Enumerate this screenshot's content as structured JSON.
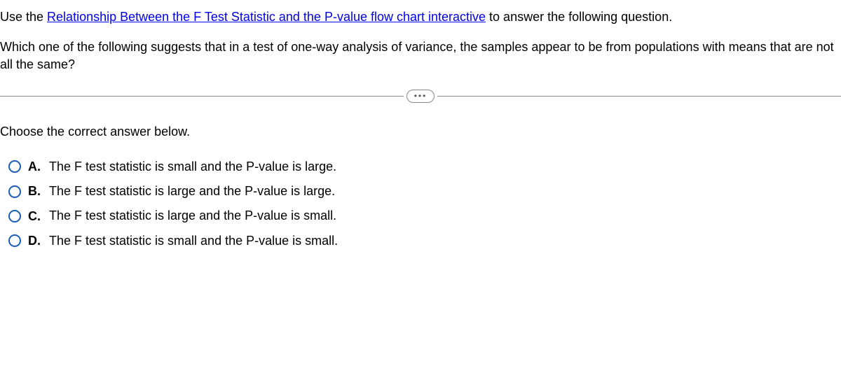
{
  "intro": {
    "prefix": "Use the ",
    "link": "Relationship Between the F Test Statistic and the P-value flow chart interactive",
    "suffix": " to answer the following question."
  },
  "question": "Which one of the following suggests that in a test of one-way analysis of variance, the samples appear to be from populations with means that are not all the same?",
  "ellipsis": "•••",
  "instruction": "Choose the correct answer below.",
  "options": [
    {
      "letter": "A.",
      "text": "The F test statistic is small and the P-value is large."
    },
    {
      "letter": "B.",
      "text": "The F test statistic is large and the P-value is large."
    },
    {
      "letter": "C.",
      "text": "The F test statistic is large and the P-value is small."
    },
    {
      "letter": "D.",
      "text": "The F test statistic is small and the P-value is small."
    }
  ]
}
